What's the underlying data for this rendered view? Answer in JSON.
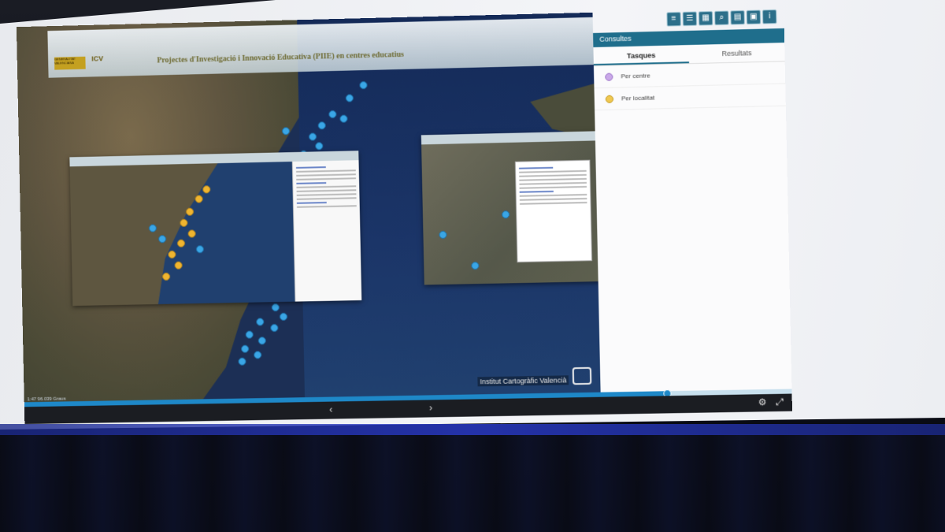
{
  "app": {
    "header_title": "Projectes d'Investigació i Innovació Educativa (PIIE) en centres educatius",
    "logo1": "GENERALITAT VALENCIANA",
    "logo2": "ICV"
  },
  "toolbar": {
    "icons": [
      "layers-icon",
      "list-icon",
      "grid-icon",
      "search-icon",
      "table-icon",
      "print-icon",
      "info-icon"
    ]
  },
  "panel": {
    "title": "Consultes",
    "tabs": [
      "Tasques",
      "Resultats"
    ],
    "active_tab": "Tasques",
    "options": [
      {
        "label": "Per centre",
        "color": "#c9a8e8"
      },
      {
        "label": "Per localitat",
        "color": "#f0c850"
      }
    ]
  },
  "map": {
    "credit": "Institut Cartogràfic Valencià",
    "scale": "1:47 96.039 Graus"
  },
  "player": {
    "progress": 0.84,
    "prev": "‹",
    "next": "›"
  },
  "colors": {
    "accent": "#1f6e8c",
    "dot_blue": "#3aa6e6",
    "dot_yellow": "#f0b530",
    "progress": "#1e88c8"
  }
}
